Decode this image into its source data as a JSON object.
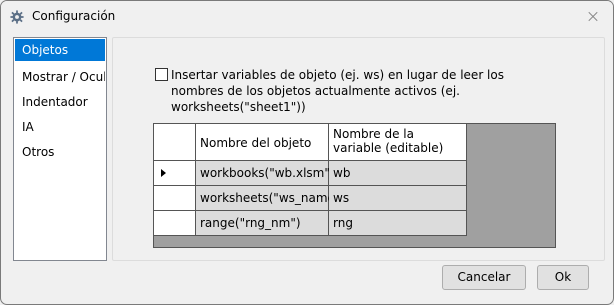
{
  "window": {
    "title": "Configuración",
    "title_icon": "gear-icon",
    "close_icon": "close-icon"
  },
  "nav": {
    "items": [
      {
        "label": "Objetos",
        "selected": true
      },
      {
        "label": "Mostrar / Ocultar",
        "selected": false
      },
      {
        "label": "Indentador",
        "selected": false
      },
      {
        "label": "IA",
        "selected": false
      },
      {
        "label": "Otros",
        "selected": false
      }
    ]
  },
  "options": {
    "use_object_variables": {
      "checked": false,
      "label": "Insertar variables de objeto (ej. ws) en lugar de leer los nombres de los objetos actualmente activos (ej. worksheets(\"sheet1\"))"
    }
  },
  "grid": {
    "columns": [
      "Nombre del objeto",
      "Nombre de la variable (editable)"
    ],
    "rows": [
      {
        "object": "workbooks(\"wb.xlsm\")",
        "variable": "wb",
        "current": true
      },
      {
        "object": "worksheets(\"ws_name\")",
        "variable": "ws",
        "current": false
      },
      {
        "object": "range(\"rng_nm\")",
        "variable": "rng",
        "current": false
      }
    ]
  },
  "buttons": {
    "cancel": "Cancelar",
    "ok": "Ok"
  },
  "colors": {
    "selection": "#0078d7",
    "grid_background": "#a0a0a0",
    "cell_background": "#dcdcdc"
  }
}
